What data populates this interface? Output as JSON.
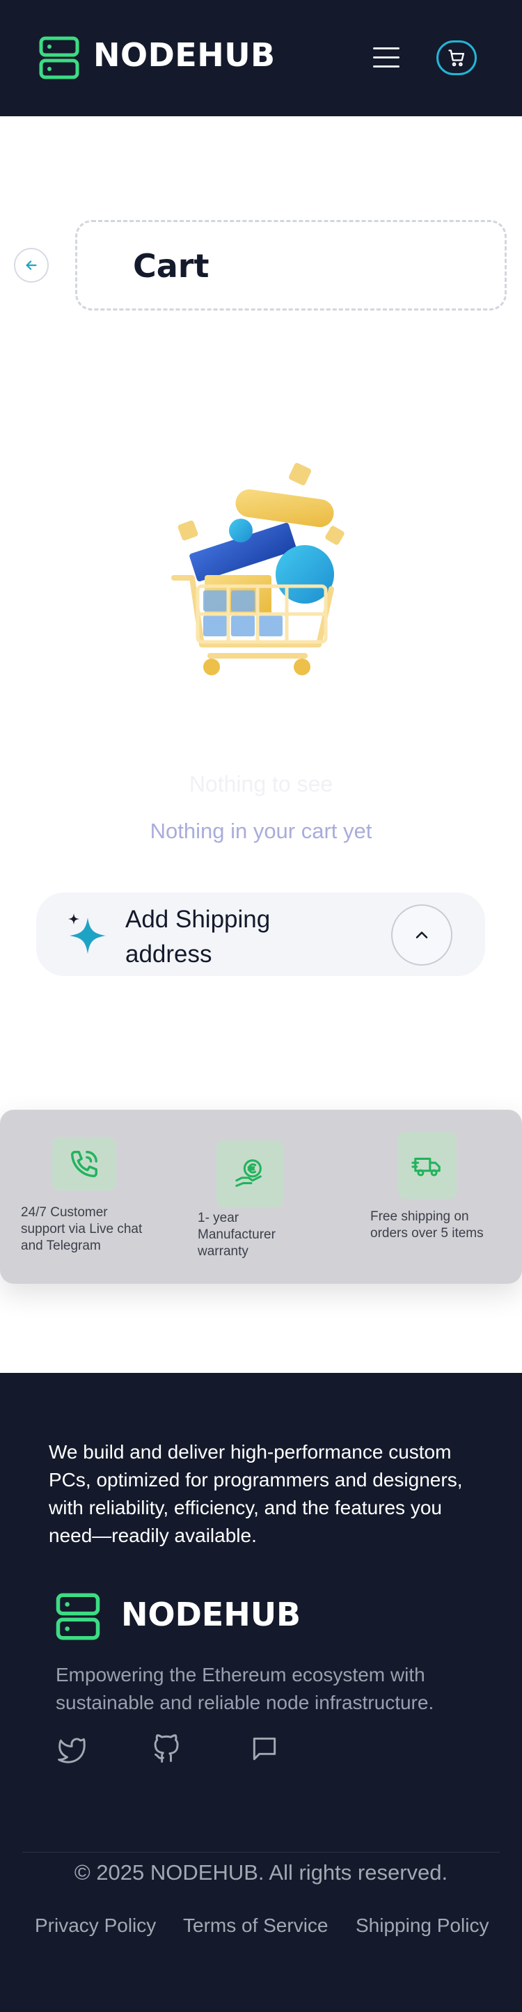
{
  "header": {
    "brand": "NODEHUB",
    "menu_icon": "hamburger-menu-icon",
    "cart_icon": "shopping-cart-icon",
    "brand_color": "#3ddc84",
    "background": "#141a2b"
  },
  "cart": {
    "title": "Cart",
    "back_icon": "arrow-left-icon",
    "empty_heading": "Nothing to see",
    "empty_message": "Nothing in your cart yet",
    "illustration": "empty-shopping-cart-illustration"
  },
  "shipping": {
    "label": "Add Shipping address",
    "icon": "sparkle-icon",
    "toggle_icon": "chevron-up-icon"
  },
  "features": [
    {
      "icon": "phone-support-icon",
      "text": "24/7 Customer support via Live chat and Telegram"
    },
    {
      "icon": "euro-hand-warranty-icon",
      "text": "1- year Manufacturer warranty"
    },
    {
      "icon": "delivery-truck-icon",
      "text": "Free shipping on orders over 5 items"
    }
  ],
  "footer": {
    "about": "We build and deliver high-performance custom PCs, optimized for programmers and designers, with reliability, efficiency, and the features you need—readily available.",
    "brand": "NODEHUB",
    "tagline": "Empowering the Ethereum ecosystem with sustainable and reliable node infrastructure.",
    "social": [
      "twitter-icon",
      "github-icon",
      "chat-icon"
    ],
    "copyright": "© 2025 NODEHUB. All rights reserved.",
    "links": [
      "Privacy Policy",
      "Terms of Service",
      "Shipping Policy"
    ]
  },
  "colors": {
    "accent_green": "#3ddc84",
    "accent_cyan": "#23b4d6",
    "empty_text": "#a9acdb",
    "footer_bg": "#141a2b"
  }
}
